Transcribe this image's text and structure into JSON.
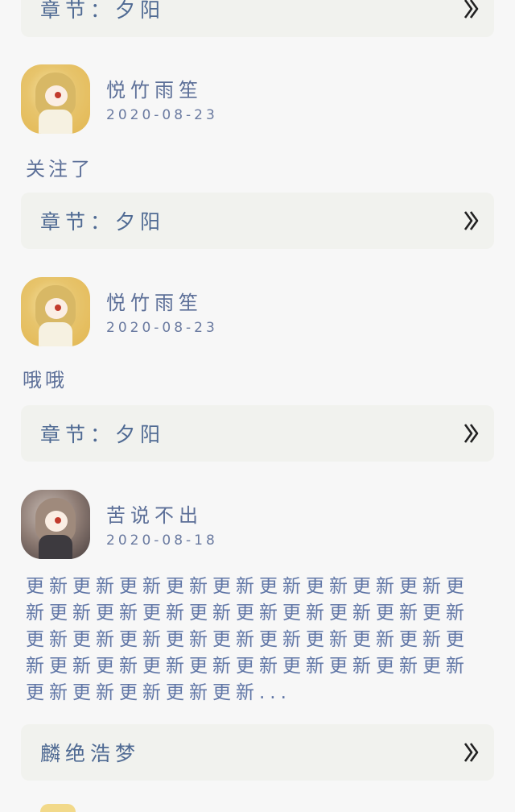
{
  "cards": [
    {
      "label": "章节：夕阳"
    },
    {
      "label": "章节：夕阳"
    },
    {
      "label": "章节：夕阳"
    },
    {
      "label": "麟绝浩梦"
    }
  ],
  "comments": [
    {
      "username": "悦竹雨笙",
      "date": "2020-08-23",
      "text": "关注了"
    },
    {
      "username": "悦竹雨笙",
      "date": "2020-08-23",
      "text": "哦哦"
    },
    {
      "username": "苦说不出",
      "date": "2020-08-18",
      "text": "更新更新更新更新更新更新更新更新更新更新更新更新更新更新更新更新更新更新更新更新更新更新更新更新更新更新更新更新更新更新更新更新更新更新更新更新更新更新更新更新更新更新更新..."
    }
  ]
}
